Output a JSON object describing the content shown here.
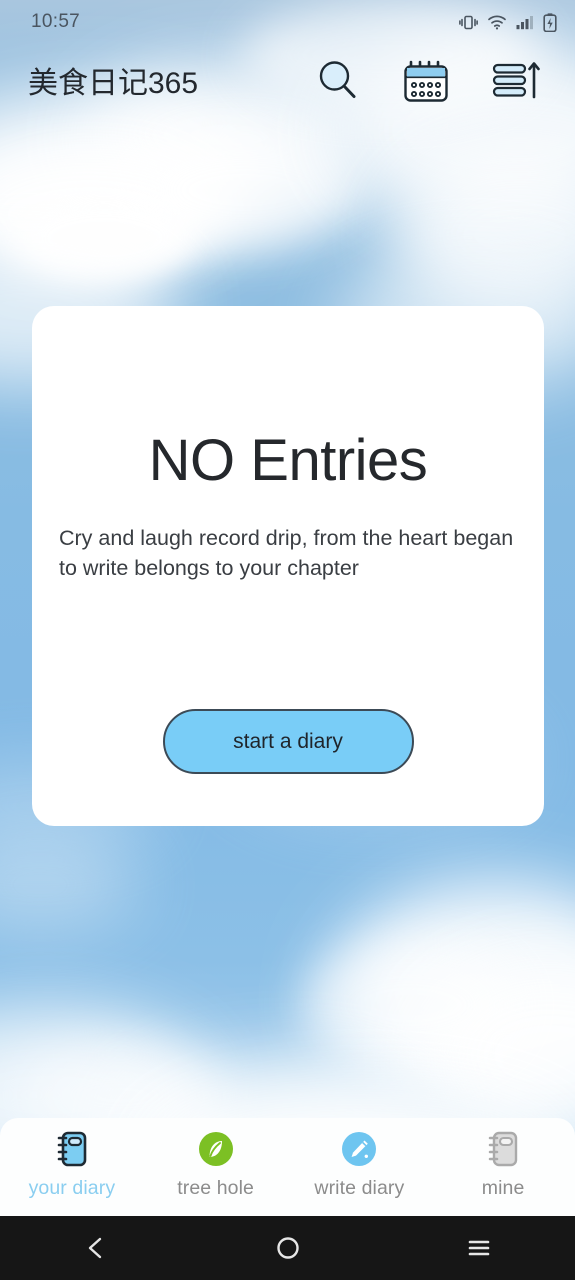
{
  "status_bar": {
    "time": "10:57",
    "icons": [
      "vibrate-icon",
      "wifi-icon",
      "signal-icon",
      "battery-charging-icon"
    ]
  },
  "app_bar": {
    "title": "美食日记365",
    "actions": [
      {
        "name": "search-icon",
        "label": "search"
      },
      {
        "name": "calendar-icon",
        "label": "calendar"
      },
      {
        "name": "sort-icon",
        "label": "sort"
      }
    ]
  },
  "card": {
    "title": "NO Entries",
    "subtitle": "Cry and laugh record drip, from the heart began to write belongs to your chapter",
    "primary_button": "start a diary"
  },
  "tab_bar": {
    "active_index": 0,
    "items": [
      {
        "label": "your diary",
        "icon": "notebook-icon",
        "active": true
      },
      {
        "label": "tree hole",
        "icon": "leaf-circle-icon",
        "active": false
      },
      {
        "label": "write diary",
        "icon": "pencil-circle-icon",
        "active": false
      },
      {
        "label": "mine",
        "icon": "notebook-gray-icon",
        "active": false
      }
    ]
  },
  "nav_bar": {
    "items": [
      {
        "label": "back",
        "icon": "back-chevron-icon"
      },
      {
        "label": "home",
        "icon": "home-circle-icon"
      },
      {
        "label": "recents",
        "icon": "recents-menu-icon"
      }
    ]
  },
  "colors": {
    "sky": "#8cbfe3",
    "card": "#ffffff",
    "accent_blue": "#79cdf7",
    "active_tab": "#8acef0",
    "tree_hole_green": "#7cc024",
    "write_diary_blue": "#6ec5f0",
    "inactive_gray": "#8c8c8c",
    "nav_bar": "#161616"
  }
}
